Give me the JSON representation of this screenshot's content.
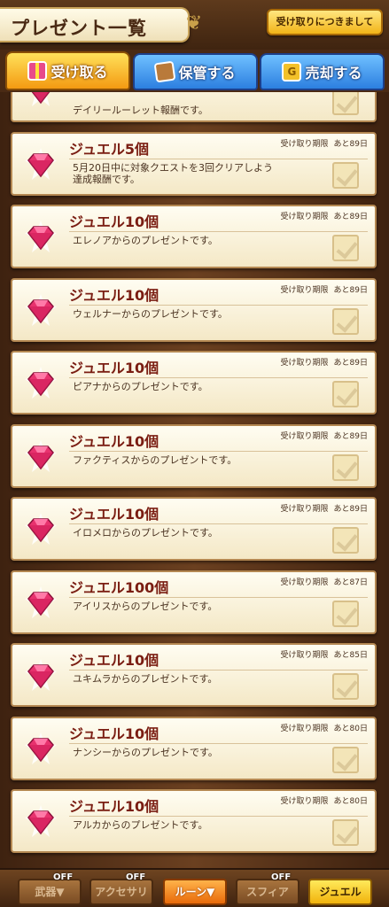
{
  "header": {
    "title": "プレゼント一覧",
    "guide_button": "受け取りにつきまして"
  },
  "tabs": [
    {
      "label": "受け取る",
      "icon": "gift-icon",
      "active": true
    },
    {
      "label": "保管する",
      "icon": "box-icon",
      "active": false
    },
    {
      "label": "売却する",
      "icon": "coin-icon",
      "active": false
    }
  ],
  "deadline_label": "受け取り期限",
  "items": [
    {
      "name": "",
      "desc": "デイリールーレット報酬です。",
      "days": "",
      "partial": true
    },
    {
      "name": "ジュエル5個",
      "desc": "5月20日中に対象クエストを3回クリアしよう達成報酬です。",
      "days": "あと89日"
    },
    {
      "name": "ジュエル10個",
      "desc": "エレノアからのプレゼントです。",
      "days": "あと89日"
    },
    {
      "name": "ジュエル10個",
      "desc": "ウェルナーからのプレゼントです。",
      "days": "あと89日"
    },
    {
      "name": "ジュエル10個",
      "desc": "ピアナからのプレゼントです。",
      "days": "あと89日"
    },
    {
      "name": "ジュエル10個",
      "desc": "ファクティスからのプレゼントです。",
      "days": "あと89日"
    },
    {
      "name": "ジュエル10個",
      "desc": "イロメロからのプレゼントです。",
      "days": "あと89日"
    },
    {
      "name": "ジュエル100個",
      "desc": "アイリスからのプレゼントです。",
      "days": "あと87日"
    },
    {
      "name": "ジュエル10個",
      "desc": "ユキムラからのプレゼントです。",
      "days": "あと85日"
    },
    {
      "name": "ジュエル10個",
      "desc": "ナンシーからのプレゼントです。",
      "days": "あと80日"
    },
    {
      "name": "ジュエル10個",
      "desc": "アルカからのプレゼントです。",
      "days": "あと80日"
    }
  ],
  "filters": [
    {
      "label": "武器▼",
      "off": "OFF",
      "style": "dim"
    },
    {
      "label": "アクセサリ",
      "off": "OFF",
      "style": "dim"
    },
    {
      "label": "ルーン▼",
      "off": "",
      "style": "orange"
    },
    {
      "label": "スフィア",
      "off": "OFF",
      "style": "dim"
    },
    {
      "label": "ジュエル",
      "off": "",
      "style": "yellow"
    }
  ],
  "colors": {
    "active_tab": "#f39a12",
    "inactive_tab": "#2c7fe0",
    "item_name": "#7a1d12",
    "background": "#4a2a14"
  }
}
